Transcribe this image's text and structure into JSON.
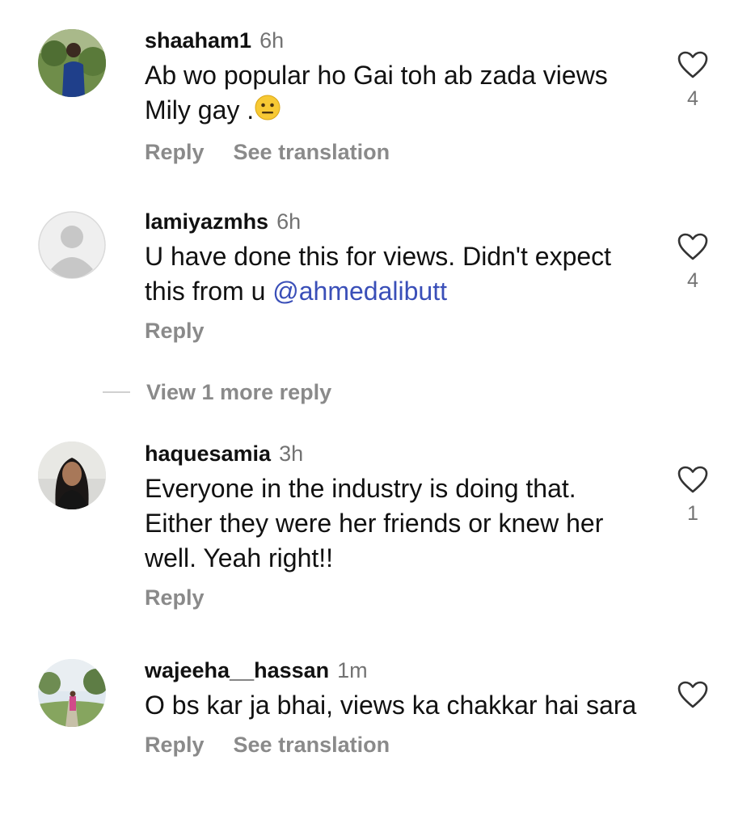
{
  "comments": [
    {
      "username": "shaaham1",
      "time": "6h",
      "text": "Ab wo popular ho Gai toh ab zada views Mily gay .",
      "emoji": "neutral-face-emoji",
      "reply_label": "Reply",
      "translation_label": "See translation",
      "likes": "4"
    },
    {
      "username": "lamiyazmhs",
      "time": "6h",
      "text": "U have done this for views. Didn't expect this from u ",
      "mention": "@ahmedalibutt",
      "reply_label": "Reply",
      "likes": "4"
    },
    {
      "username": "haquesamia",
      "time": "3h",
      "text": "Everyone in the industry is doing that. Either they were her friends or knew her well. Yeah right!!",
      "reply_label": "Reply",
      "likes": "1"
    },
    {
      "username": "wajeeha__hassan",
      "time": "1m",
      "text": "O bs kar ja bhai, views ka chakkar hai sara",
      "reply_label": "Reply",
      "translation_label": "See translation",
      "likes": ""
    }
  ],
  "view_more_label": "View 1 more reply",
  "colors": {
    "mention": "#3a4fb8",
    "secondary": "#737373",
    "action": "#8a8a8a"
  }
}
